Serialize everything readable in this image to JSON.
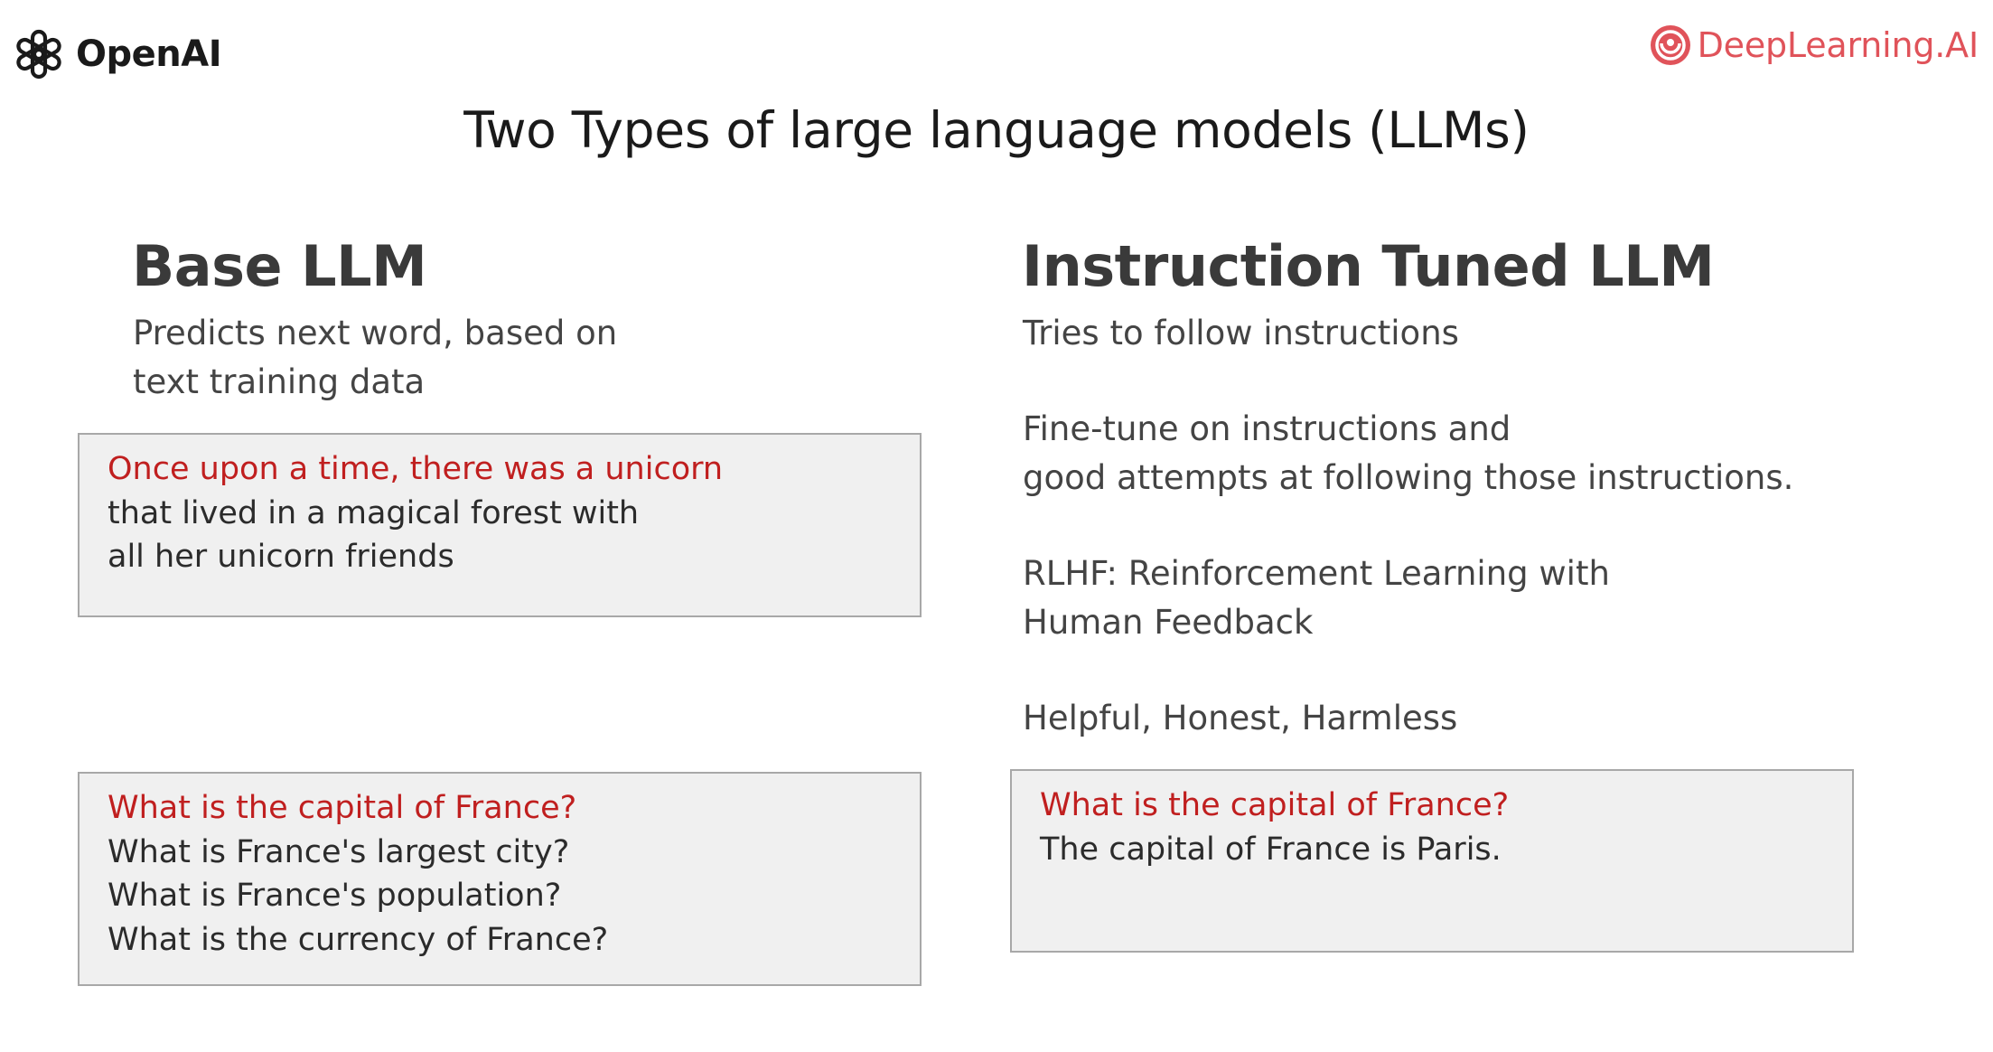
{
  "header": {
    "openai_logo": {
      "icon": "openai-knot-icon",
      "text": "OpenAI"
    },
    "deeplearning_logo": {
      "icon": "deeplearning-swirl-icon",
      "text": "DeepLearning.AI"
    }
  },
  "title": "Two Types of large language models (LLMs)",
  "left_column": {
    "heading": "Base LLM",
    "description": [
      "Predicts next word, based on",
      "text training data"
    ],
    "example_1": {
      "prompt": "Once upon a time, there was a unicorn",
      "completion": [
        "that lived in a magical forest with",
        "all her unicorn friends"
      ]
    },
    "example_2": {
      "prompt": "What is the capital of France?",
      "completion": [
        "What is France's largest city?",
        "What is France's population?",
        "What is the currency of France?"
      ]
    }
  },
  "right_column": {
    "heading": "Instruction Tuned LLM",
    "description": "Tries to follow instructions",
    "finetune": [
      "Fine-tune on instructions and",
      "good attempts at following those instructions."
    ],
    "rlhf": [
      "RLHF: Reinforcement Learning with",
      "Human Feedback"
    ],
    "hhh": "Helpful, Honest, Harmless",
    "example": {
      "prompt": "What is the capital of France?",
      "completion": [
        "The capital of France is Paris."
      ]
    }
  },
  "colors": {
    "prompt_text": "#c01f1f",
    "box_background": "#f0f0f0",
    "box_border": "#a8a8a8",
    "deeplearning_brand": "#e0535a"
  }
}
